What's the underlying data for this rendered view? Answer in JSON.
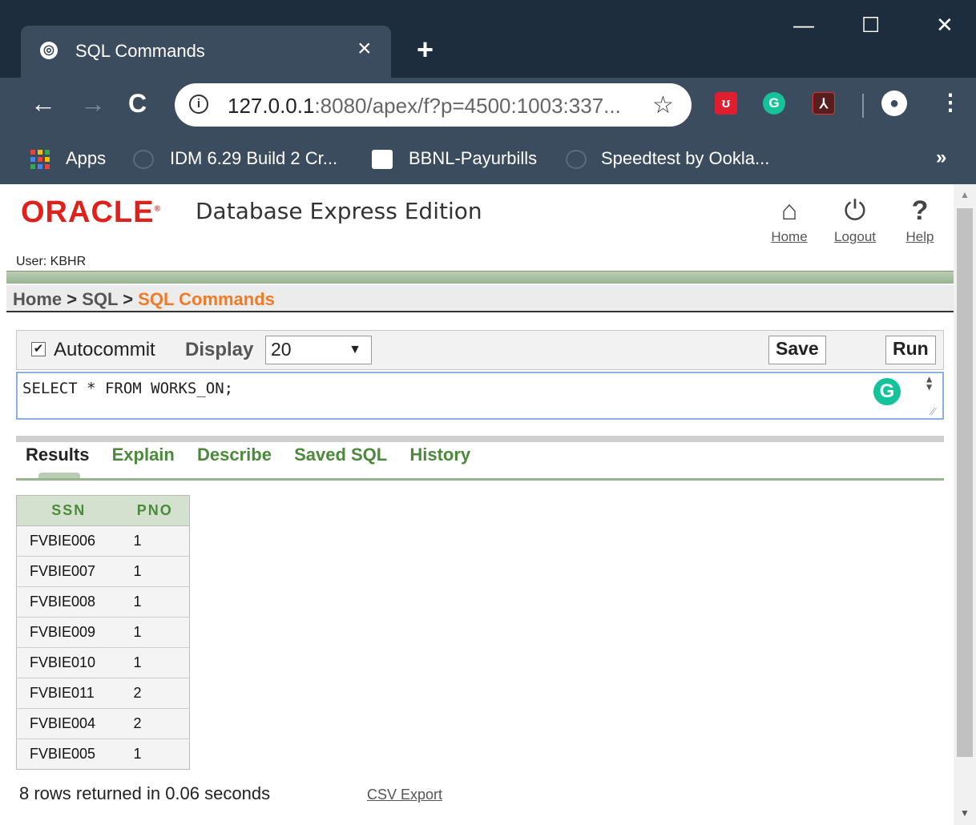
{
  "browser": {
    "tab_title": "SQL Commands",
    "tab_close": "×",
    "new_tab": "+",
    "window_minimize": "—",
    "window_maximize": "☐",
    "window_close": "✕",
    "nav_back": "←",
    "nav_forward": "→",
    "nav_reload": "C",
    "url_host": "127.0.0.1",
    "url_rest": ":8080/apex/f?p=4500:1003:337...",
    "bookmark_star": "☆",
    "extensions": [
      "shield-extension",
      "grammarly-extension",
      "pdf-extension"
    ],
    "profile_icon": "person-icon",
    "menu": "⋮",
    "bookmarks": {
      "apps_label": "Apps",
      "items": [
        "IDM 6.29 Build 2 Cr...",
        "BBNL-Payurbills",
        "Speedtest by Ookla..."
      ],
      "more": "»"
    }
  },
  "header": {
    "logo_text": "ORACLE",
    "product_name": "Database Express Edition",
    "nav": [
      {
        "label": "Home",
        "icon": "home-icon"
      },
      {
        "label": "Logout",
        "icon": "power-icon"
      },
      {
        "label": "Help",
        "icon": "help-icon"
      }
    ],
    "user": "User: KBHR"
  },
  "breadcrumb": {
    "home": "Home",
    "sql": "SQL",
    "separator": ">",
    "current": "SQL Commands"
  },
  "command_panel": {
    "autocommit_checked": true,
    "autocommit_label": "Autocommit",
    "display_label": "Display",
    "display_value": "20",
    "save_label": "Save",
    "run_label": "Run"
  },
  "editor": {
    "sql_text": "SELECT * FROM WORKS_ON;"
  },
  "tabs": [
    "Results",
    "Explain",
    "Describe",
    "Saved SQL",
    "History"
  ],
  "active_tab": "Results",
  "results": {
    "columns": [
      "SSN",
      "PNO"
    ],
    "rows": [
      [
        "FVBIE006",
        "1"
      ],
      [
        "FVBIE007",
        "1"
      ],
      [
        "FVBIE008",
        "1"
      ],
      [
        "FVBIE009",
        "1"
      ],
      [
        "FVBIE010",
        "1"
      ],
      [
        "FVBIE011",
        "2"
      ],
      [
        "FVBIE004",
        "2"
      ],
      [
        "FVBIE005",
        "1"
      ]
    ],
    "summary": "8 rows returned in 0.06 seconds",
    "csv_export": "CSV Export"
  },
  "colors": {
    "titlebar": "#1e2d3d",
    "toolbar": "#3b4c5e",
    "oracle_red": "#e0201b",
    "breadcrumb_current": "#f07b27",
    "tab_green": "#4a8a3a",
    "band_green": "#98b491"
  }
}
